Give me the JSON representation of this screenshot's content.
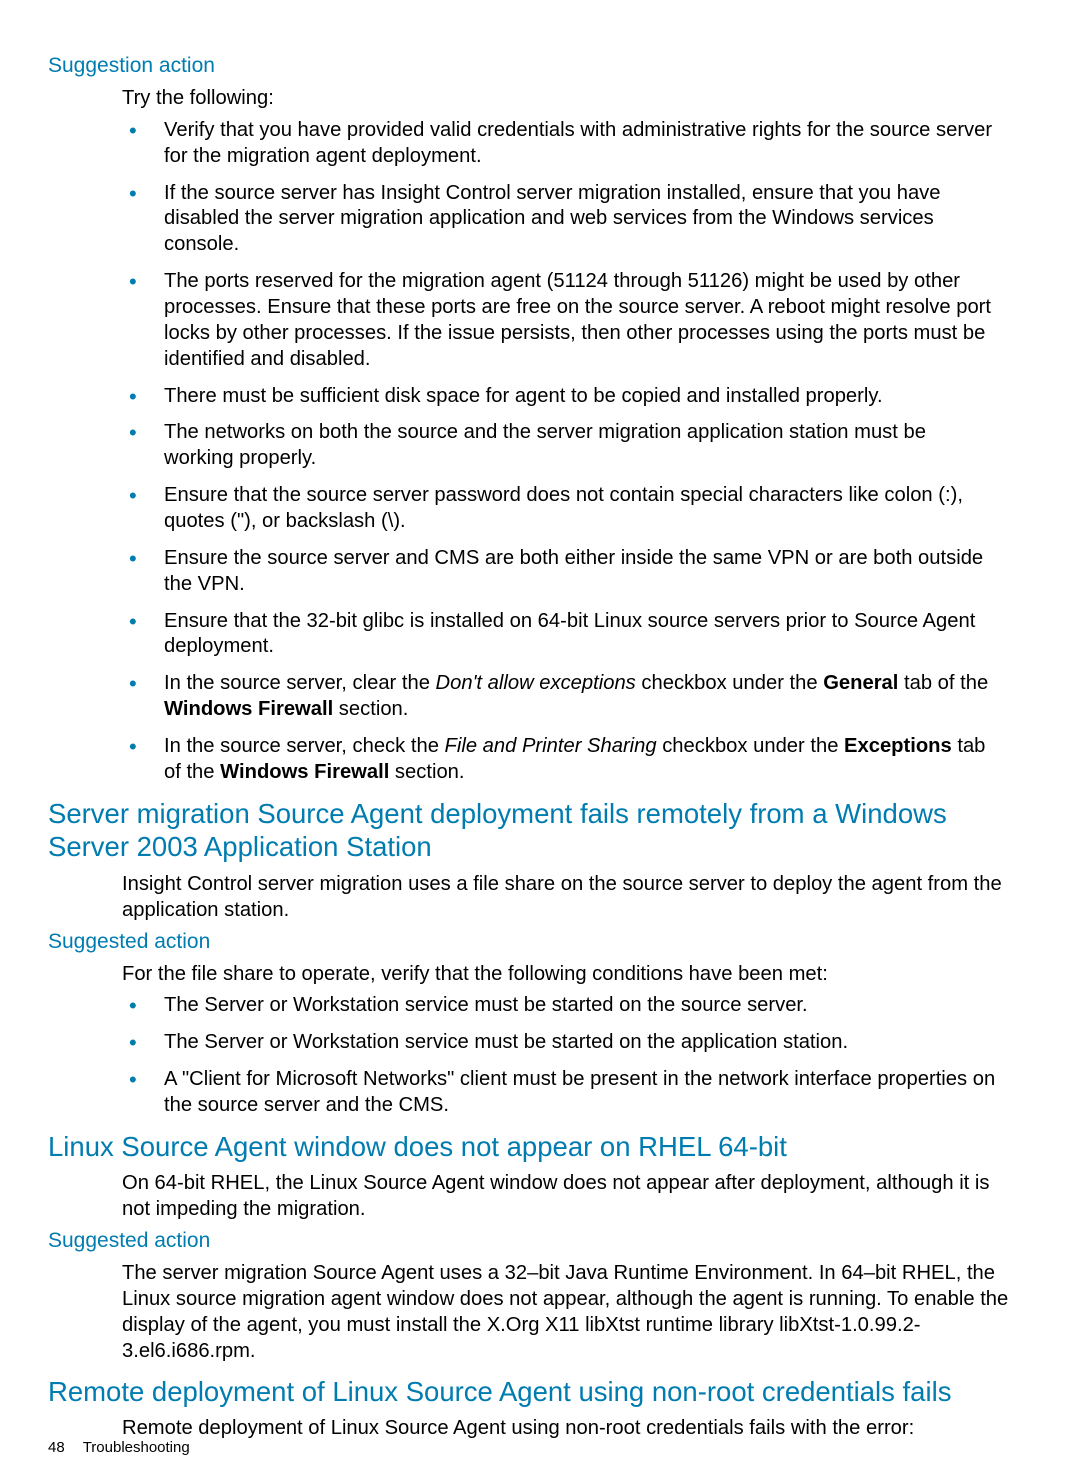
{
  "sections": [
    {
      "h3": "Suggestion action",
      "intro": "Try the following:",
      "bullets": [
        {
          "text": "Verify that you have provided valid credentials with administrative rights for the source server for the migration agent deployment."
        },
        {
          "text": "If the source server has Insight Control server migration installed, ensure that you have disabled the server migration application and web services from the Windows services console."
        },
        {
          "text": "The ports reserved for the migration agent (51124 through 51126) might be used by other processes. Ensure that these ports are free on the source server. A reboot might resolve port locks by other processes. If the issue persists, then other processes using the ports must be identified and disabled."
        },
        {
          "text": "There must be sufficient disk space for agent to be copied and installed properly."
        },
        {
          "text": "The networks on both the source and the server migration application station must be working properly."
        },
        {
          "text": "Ensure that the source server password does not contain special characters like colon (:), quotes (\"), or backslash (\\)."
        },
        {
          "text": "Ensure the source server and CMS are both either inside the same VPN or are both outside the VPN."
        },
        {
          "text": "Ensure that the 32-bit glibc is installed on 64-bit Linux source servers prior to Source Agent deployment."
        },
        {
          "pre": "In the source server, clear the ",
          "italic": "Don't allow exceptions",
          "mid": " checkbox under the ",
          "bold1": "General",
          "mid2": " tab of the ",
          "bold2": "Windows Firewall",
          "post": " section."
        },
        {
          "pre": "In the source server, check the ",
          "italic": "File and Printer Sharing",
          "mid": " checkbox under the ",
          "bold1": "Exceptions",
          "mid2": " tab of the ",
          "bold2": "Windows Firewall",
          "post": " section."
        }
      ]
    },
    {
      "h2": "Server migration Source Agent deployment fails remotely from a Windows Server 2003 Application Station",
      "intro": "Insight Control server migration uses a file share on the source server to deploy the agent from the application station."
    },
    {
      "h3": "Suggested action",
      "intro": "For the file share to operate, verify that the following conditions have been met:",
      "bullets": [
        {
          "text": "The Server or Workstation service must be started on the source server."
        },
        {
          "text": "The Server or Workstation service must be started on the application station."
        },
        {
          "text": "A \"Client for Microsoft Networks\" client must be present in the network interface properties on the source server and the CMS."
        }
      ]
    },
    {
      "h2": "Linux Source Agent window does not appear on RHEL 64-bit",
      "intro": "On 64-bit RHEL, the Linux Source Agent window does not appear after deployment, although it is not impeding the migration."
    },
    {
      "h3": "Suggested action",
      "intro": "The server migration Source Agent uses a 32–bit Java Runtime Environment. In 64–bit RHEL, the Linux source migration agent window does not appear, although the agent is running. To enable the display of the agent, you must install the X.Org X11 libXtst runtime library libXtst-1.0.99.2-3.el6.i686.rpm."
    },
    {
      "h2": "Remote deployment of Linux Source Agent using non-root credentials fails",
      "intro": "Remote deployment of Linux Source Agent using non-root credentials fails with the error:"
    }
  ],
  "footer": {
    "page_number": "48",
    "section_label": "Troubleshooting"
  }
}
